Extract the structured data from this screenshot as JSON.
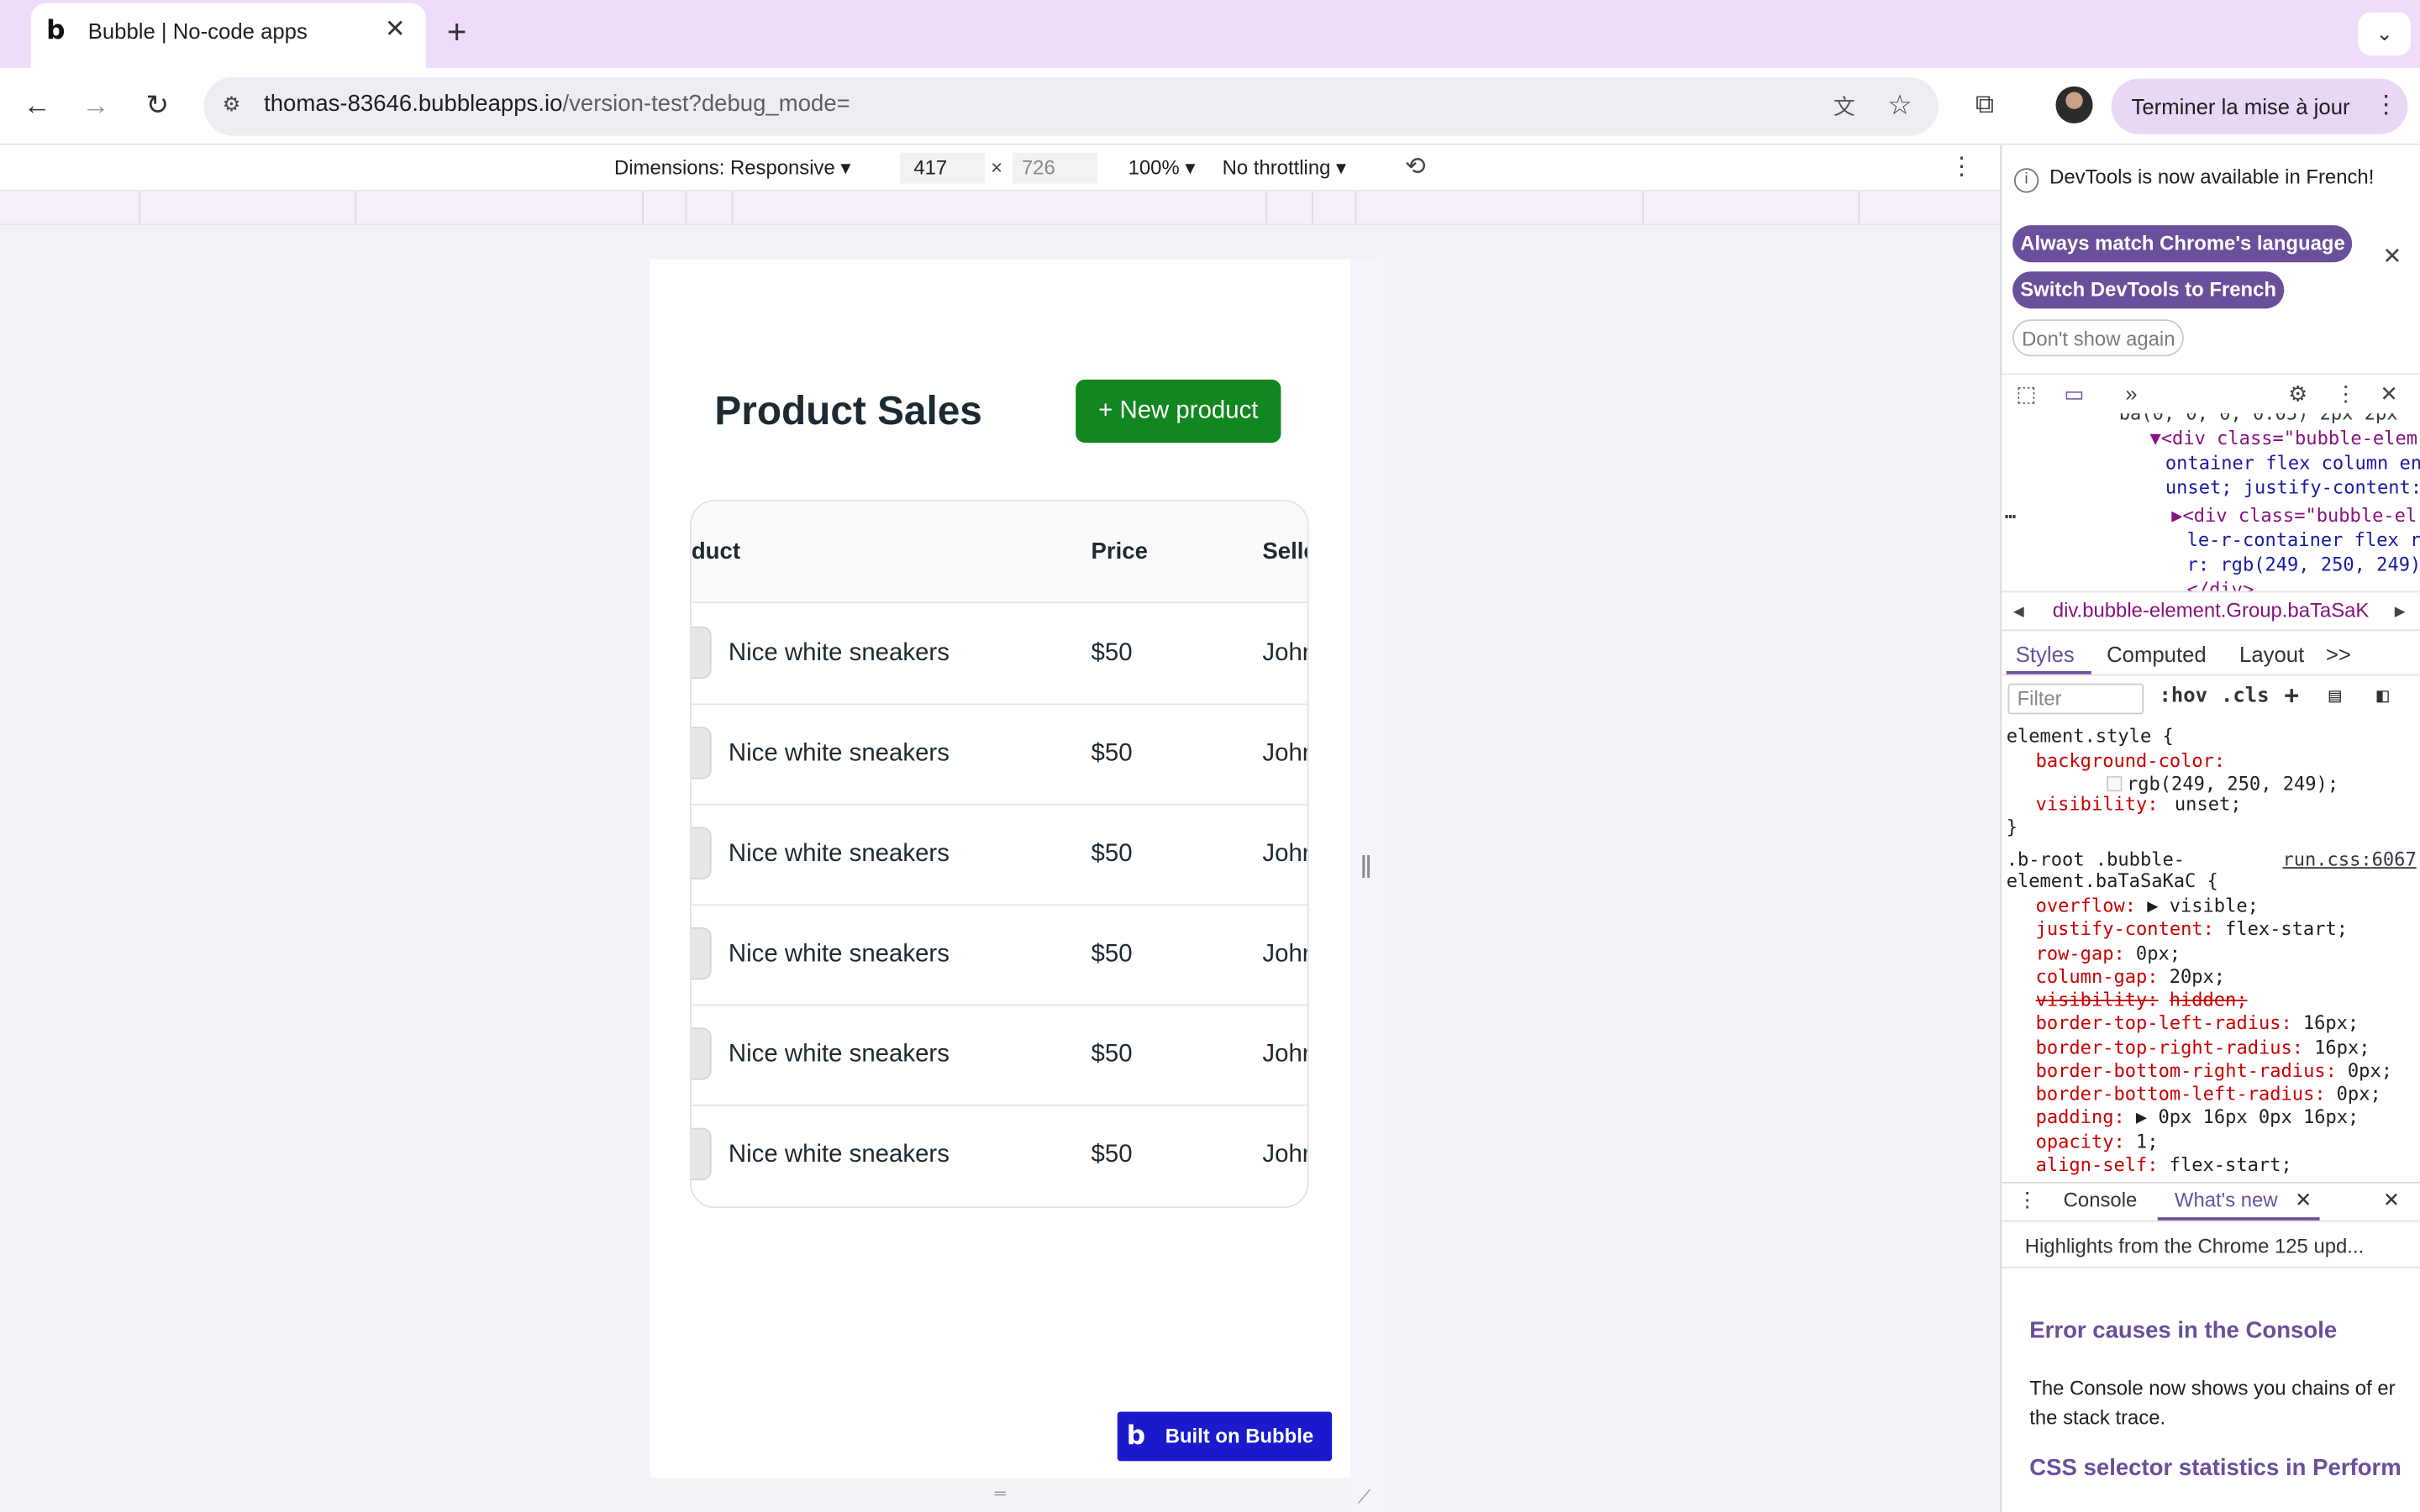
{
  "browser": {
    "tab_title": "Bubble | No-code apps",
    "url_host": "thomas-83646.bubbleapps.io",
    "url_path": "/version-test?debug_mode=",
    "update_button": "Terminer la mise à jour"
  },
  "device_toolbar": {
    "dimensions": "Dimensions: Responsive ▾",
    "width": "417",
    "times": "×",
    "height": "726",
    "zoom": "100% ▾",
    "throttling": "No throttling ▾"
  },
  "app": {
    "title": "Product Sales",
    "new_button": "+ New product",
    "table": {
      "headers": [
        "duct",
        "Price",
        "Selle"
      ],
      "rows": [
        {
          "product": "Nice white sneakers",
          "price": "$50",
          "seller": "Johr"
        },
        {
          "product": "Nice white sneakers",
          "price": "$50",
          "seller": "Johr"
        },
        {
          "product": "Nice white sneakers",
          "price": "$50",
          "seller": "Johr"
        },
        {
          "product": "Nice white sneakers",
          "price": "$50",
          "seller": "Johr"
        },
        {
          "product": "Nice white sneakers",
          "price": "$50",
          "seller": "Johr"
        },
        {
          "product": "Nice white sneakers",
          "price": "$50",
          "seller": "Johr"
        }
      ]
    },
    "built_on": "Built on Bubble"
  },
  "devtools": {
    "lang_notice": "DevTools is now available in French!",
    "chip_match": "Always match Chrome's language",
    "chip_switch": "Switch DevTools to French",
    "chip_dont": "Don't show again",
    "elements": [
      {
        "text": "ba(0, 0, 0, 0.05) 2px 2px",
        "cls": "txtc"
      },
      {
        "text": "▼<div class=\"bubble-elem",
        "cls": "tagc"
      },
      {
        "text": "ontainer flex column en",
        "cls": "valc"
      },
      {
        "text": "unset; justify-content:",
        "cls": "valc"
      },
      {
        "text": "▶<div class=\"bubble-el",
        "cls": "tagc"
      },
      {
        "text": "le-r-container flex r",
        "cls": "valc"
      },
      {
        "text": "r: rgb(249, 250, 249)",
        "cls": "valc"
      },
      {
        "text": "</div>",
        "cls": "tagc"
      }
    ],
    "breadcrumb": "div.bubble-element.Group.baTaSaK",
    "style_tabs": [
      "Styles",
      "Computed",
      "Layout",
      ">>"
    ],
    "filter_placeholder": "Filter",
    "filter_hov": ":hov",
    "filter_cls": ".cls",
    "css": {
      "element_style": "element.style {",
      "bg_prop": "background-color:",
      "bg_val": "rgb(249, 250, 249);",
      "vis_prop": "visibility:",
      "vis_val": "unset;",
      "close": "}",
      "rule_sel1": ".b-root .bubble-",
      "rule_sel2": "element.baTaSaKaC {",
      "rule_src": "run.css:6067",
      "decls": [
        {
          "p": "overflow:",
          "v": "▶ visible;",
          "strike": false
        },
        {
          "p": "justify-content:",
          "v": "flex-start;",
          "strike": false
        },
        {
          "p": "row-gap:",
          "v": "0px;",
          "strike": false
        },
        {
          "p": "column-gap:",
          "v": "20px;",
          "strike": false
        },
        {
          "p": "visibility:",
          "v": "hidden;",
          "strike": true
        },
        {
          "p": "border-top-left-radius:",
          "v": "16px;",
          "strike": false
        },
        {
          "p": "border-top-right-radius:",
          "v": "16px;",
          "strike": false
        },
        {
          "p": "border-bottom-right-radius:",
          "v": "0px;",
          "strike": false
        },
        {
          "p": "border-bottom-left-radius:",
          "v": "0px;",
          "strike": false
        },
        {
          "p": "padding:",
          "v": "▶ 0px 16px 0px 16px;",
          "strike": false
        },
        {
          "p": "opacity:",
          "v": "1;",
          "strike": false
        },
        {
          "p": "align-self:",
          "v": "flex-start;",
          "strike": false
        }
      ]
    },
    "drawer": {
      "console": "Console",
      "whats_new": "What's new",
      "subtitle": "Highlights from the Chrome 125 upd...",
      "heading1": "Error causes in the Console",
      "para1_line1": "The Console now shows you chains of er",
      "para1_line2": "the stack trace.",
      "heading2": "CSS selector statistics in Perform"
    }
  }
}
